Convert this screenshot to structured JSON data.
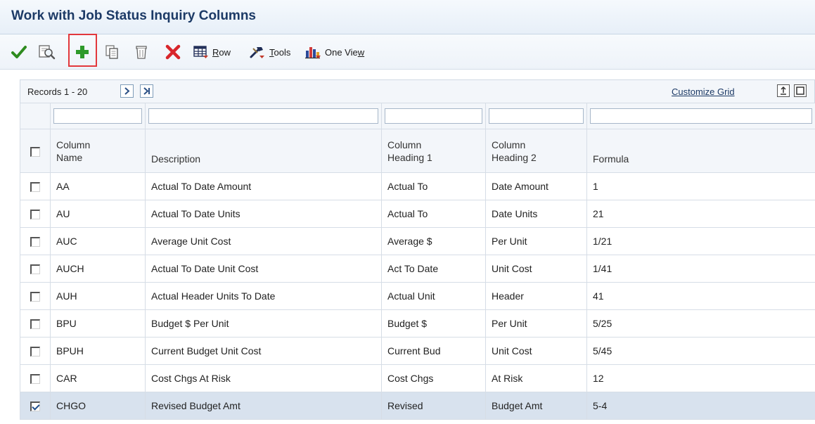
{
  "window": {
    "title": "Work with Job Status Inquiry Columns"
  },
  "toolbar": {
    "row_label_u": "R",
    "row_label_rest": "ow",
    "tools_label_u": "T",
    "tools_label_rest": "ools",
    "oneview_label_pre": "One Vie",
    "oneview_label_u": "w",
    "icons": [
      "check-icon",
      "find-icon",
      "add-icon",
      "copy-icon",
      "delete-icon",
      "close-icon",
      "row-menu-icon",
      "tools-icon",
      "one-view-icon"
    ],
    "colors": {
      "check": "#2e8b1f",
      "add": "#2e9a2a",
      "close": "#d8262b",
      "highlight": "#e2383c"
    }
  },
  "grid": {
    "records_label": "Records 1 - 20",
    "customize_label": "Customize Grid",
    "columns": [
      {
        "line1": "Column",
        "line2": "Name"
      },
      {
        "line1": "",
        "line2": "Description"
      },
      {
        "line1": "Column",
        "line2": "Heading 1"
      },
      {
        "line1": "Column",
        "line2": "Heading 2"
      },
      {
        "line1": "",
        "line2": "Formula"
      }
    ],
    "rows": [
      {
        "name": "AA",
        "description": "Actual To Date Amount",
        "heading1": "Actual To",
        "heading2": "Date Amount",
        "formula": "1",
        "checked": false
      },
      {
        "name": "AU",
        "description": "Actual To Date Units",
        "heading1": "Actual To",
        "heading2": "Date Units",
        "formula": "21",
        "checked": false
      },
      {
        "name": "AUC",
        "description": "Average Unit Cost",
        "heading1": "Average $",
        "heading2": "Per Unit",
        "formula": "1/21",
        "checked": false
      },
      {
        "name": "AUCH",
        "description": "Actual To Date Unit Cost",
        "heading1": "Act To Date",
        "heading2": "Unit Cost",
        "formula": "1/41",
        "checked": false
      },
      {
        "name": "AUH",
        "description": "Actual Header Units To Date",
        "heading1": "Actual Unit",
        "heading2": "Header",
        "formula": "41",
        "checked": false
      },
      {
        "name": "BPU",
        "description": "Budget $ Per Unit",
        "heading1": "Budget $",
        "heading2": "Per Unit",
        "formula": "5/25",
        "checked": false
      },
      {
        "name": "BPUH",
        "description": "Current Budget Unit Cost",
        "heading1": "Current Bud",
        "heading2": "Unit Cost",
        "formula": "5/45",
        "checked": false
      },
      {
        "name": "CAR",
        "description": "Cost Chgs At Risk",
        "heading1": "Cost Chgs",
        "heading2": "At Risk",
        "formula": "12",
        "checked": false
      },
      {
        "name": "CHGO",
        "description": "Revised Budget Amt",
        "heading1": "Revised",
        "heading2": "Budget Amt",
        "formula": "5-4",
        "checked": true
      }
    ]
  }
}
